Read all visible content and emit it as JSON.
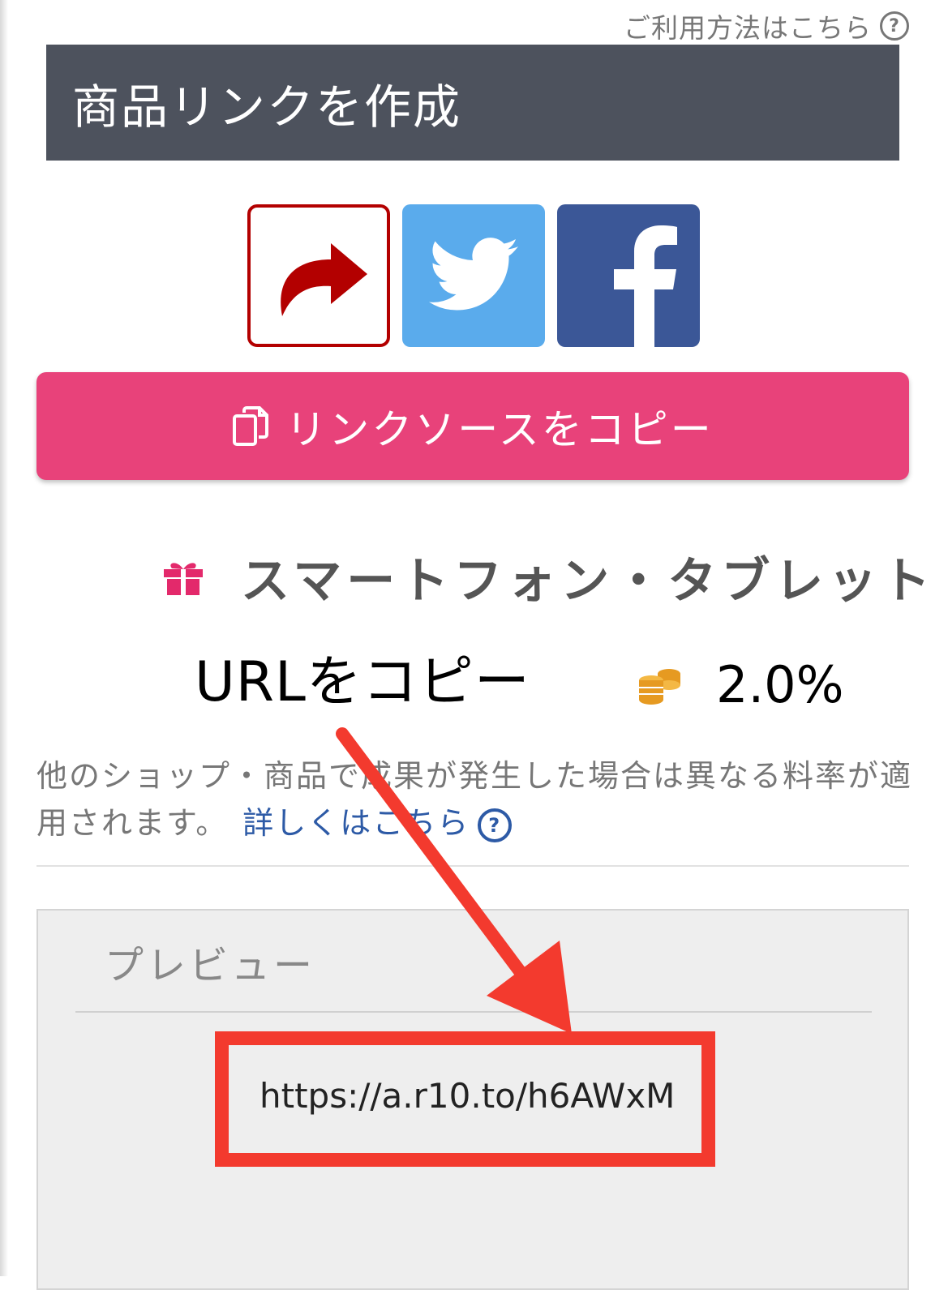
{
  "header": {
    "help_link": "ご利用方法はこちら",
    "title": "商品リンクを作成"
  },
  "share": {
    "buttons": [
      {
        "name": "share",
        "icon": "share-arrow-icon",
        "color": "#b30000"
      },
      {
        "name": "twitter",
        "icon": "twitter-bird-icon",
        "color": "#5aabec"
      },
      {
        "name": "facebook",
        "icon": "facebook-f-icon",
        "color": "#3b5797"
      }
    ]
  },
  "copy_button": {
    "icon": "copy-icon",
    "label": "リンクソースをコピー",
    "color": "#e8427a"
  },
  "category": {
    "icon": "gift-icon",
    "label": "スマートフォン・タブレット"
  },
  "annotation": {
    "text": "URLをコピー",
    "arrow_color": "#f33a2e"
  },
  "rate": {
    "icon": "coins-icon",
    "value": "2.0%"
  },
  "note": {
    "text": "他のショップ・商品で成果が発生した場合は異なる料率が適用されます。",
    "link": "詳しくはこちら"
  },
  "preview": {
    "title": "プレビュー",
    "url": "https://a.r10.to/h6AWxM"
  }
}
